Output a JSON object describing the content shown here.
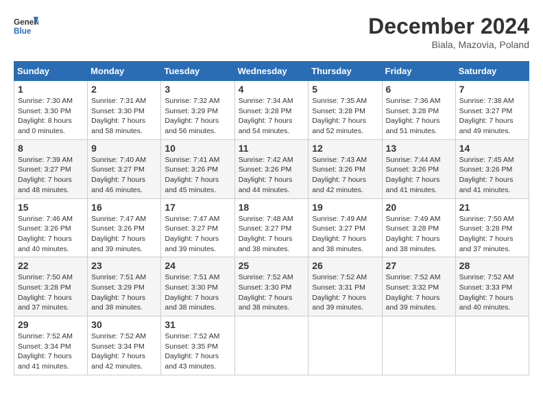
{
  "header": {
    "logo_general": "General",
    "logo_blue": "Blue",
    "month_title": "December 2024",
    "location": "Biala, Mazovia, Poland"
  },
  "weekdays": [
    "Sunday",
    "Monday",
    "Tuesday",
    "Wednesday",
    "Thursday",
    "Friday",
    "Saturday"
  ],
  "weeks": [
    [
      {
        "day": "1",
        "sunrise": "7:30 AM",
        "sunset": "3:30 PM",
        "daylight": "8 hours and 0 minutes."
      },
      {
        "day": "2",
        "sunrise": "7:31 AM",
        "sunset": "3:30 PM",
        "daylight": "7 hours and 58 minutes."
      },
      {
        "day": "3",
        "sunrise": "7:32 AM",
        "sunset": "3:29 PM",
        "daylight": "7 hours and 56 minutes."
      },
      {
        "day": "4",
        "sunrise": "7:34 AM",
        "sunset": "3:28 PM",
        "daylight": "7 hours and 54 minutes."
      },
      {
        "day": "5",
        "sunrise": "7:35 AM",
        "sunset": "3:28 PM",
        "daylight": "7 hours and 52 minutes."
      },
      {
        "day": "6",
        "sunrise": "7:36 AM",
        "sunset": "3:28 PM",
        "daylight": "7 hours and 51 minutes."
      },
      {
        "day": "7",
        "sunrise": "7:38 AM",
        "sunset": "3:27 PM",
        "daylight": "7 hours and 49 minutes."
      }
    ],
    [
      {
        "day": "8",
        "sunrise": "7:39 AM",
        "sunset": "3:27 PM",
        "daylight": "7 hours and 48 minutes."
      },
      {
        "day": "9",
        "sunrise": "7:40 AM",
        "sunset": "3:27 PM",
        "daylight": "7 hours and 46 minutes."
      },
      {
        "day": "10",
        "sunrise": "7:41 AM",
        "sunset": "3:26 PM",
        "daylight": "7 hours and 45 minutes."
      },
      {
        "day": "11",
        "sunrise": "7:42 AM",
        "sunset": "3:26 PM",
        "daylight": "7 hours and 44 minutes."
      },
      {
        "day": "12",
        "sunrise": "7:43 AM",
        "sunset": "3:26 PM",
        "daylight": "7 hours and 42 minutes."
      },
      {
        "day": "13",
        "sunrise": "7:44 AM",
        "sunset": "3:26 PM",
        "daylight": "7 hours and 41 minutes."
      },
      {
        "day": "14",
        "sunrise": "7:45 AM",
        "sunset": "3:26 PM",
        "daylight": "7 hours and 41 minutes."
      }
    ],
    [
      {
        "day": "15",
        "sunrise": "7:46 AM",
        "sunset": "3:26 PM",
        "daylight": "7 hours and 40 minutes."
      },
      {
        "day": "16",
        "sunrise": "7:47 AM",
        "sunset": "3:26 PM",
        "daylight": "7 hours and 39 minutes."
      },
      {
        "day": "17",
        "sunrise": "7:47 AM",
        "sunset": "3:27 PM",
        "daylight": "7 hours and 39 minutes."
      },
      {
        "day": "18",
        "sunrise": "7:48 AM",
        "sunset": "3:27 PM",
        "daylight": "7 hours and 38 minutes."
      },
      {
        "day": "19",
        "sunrise": "7:49 AM",
        "sunset": "3:27 PM",
        "daylight": "7 hours and 38 minutes."
      },
      {
        "day": "20",
        "sunrise": "7:49 AM",
        "sunset": "3:28 PM",
        "daylight": "7 hours and 38 minutes."
      },
      {
        "day": "21",
        "sunrise": "7:50 AM",
        "sunset": "3:28 PM",
        "daylight": "7 hours and 37 minutes."
      }
    ],
    [
      {
        "day": "22",
        "sunrise": "7:50 AM",
        "sunset": "3:28 PM",
        "daylight": "7 hours and 37 minutes."
      },
      {
        "day": "23",
        "sunrise": "7:51 AM",
        "sunset": "3:29 PM",
        "daylight": "7 hours and 38 minutes."
      },
      {
        "day": "24",
        "sunrise": "7:51 AM",
        "sunset": "3:30 PM",
        "daylight": "7 hours and 38 minutes."
      },
      {
        "day": "25",
        "sunrise": "7:52 AM",
        "sunset": "3:30 PM",
        "daylight": "7 hours and 38 minutes."
      },
      {
        "day": "26",
        "sunrise": "7:52 AM",
        "sunset": "3:31 PM",
        "daylight": "7 hours and 39 minutes."
      },
      {
        "day": "27",
        "sunrise": "7:52 AM",
        "sunset": "3:32 PM",
        "daylight": "7 hours and 39 minutes."
      },
      {
        "day": "28",
        "sunrise": "7:52 AM",
        "sunset": "3:33 PM",
        "daylight": "7 hours and 40 minutes."
      }
    ],
    [
      {
        "day": "29",
        "sunrise": "7:52 AM",
        "sunset": "3:34 PM",
        "daylight": "7 hours and 41 minutes."
      },
      {
        "day": "30",
        "sunrise": "7:52 AM",
        "sunset": "3:34 PM",
        "daylight": "7 hours and 42 minutes."
      },
      {
        "day": "31",
        "sunrise": "7:52 AM",
        "sunset": "3:35 PM",
        "daylight": "7 hours and 43 minutes."
      },
      null,
      null,
      null,
      null
    ]
  ]
}
